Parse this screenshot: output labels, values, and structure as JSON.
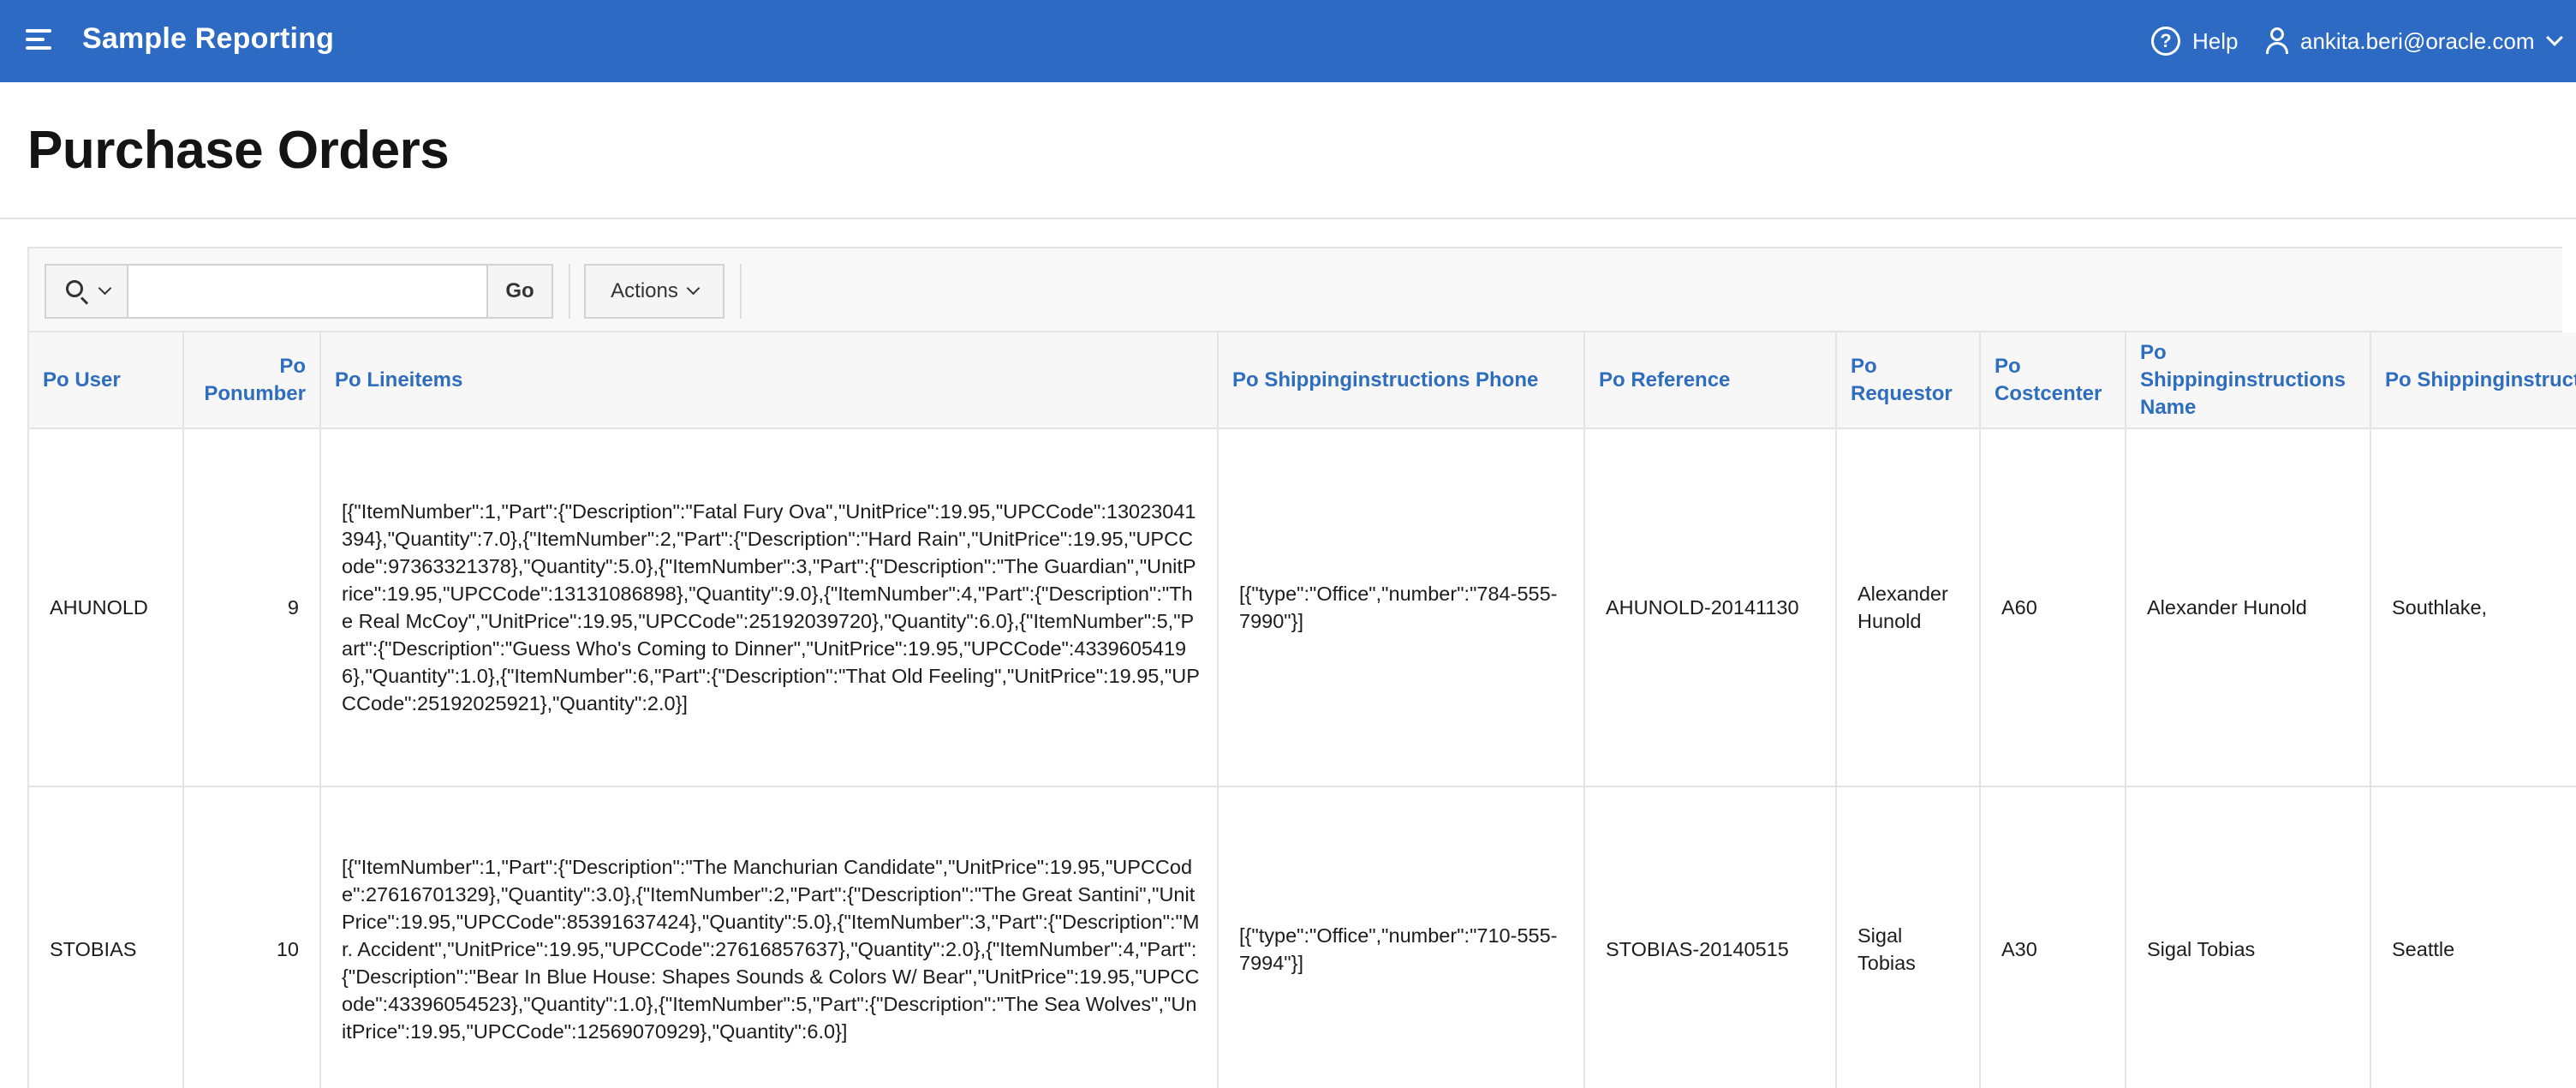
{
  "header": {
    "app_title": "Sample Reporting",
    "help_label": "Help",
    "user_email": "ankita.beri@oracle.com"
  },
  "page": {
    "title": "Purchase Orders"
  },
  "toolbar": {
    "search_value": "",
    "go_label": "Go",
    "actions_label": "Actions"
  },
  "table": {
    "columns": [
      "Po User",
      "Po Ponumber",
      "Po Lineitems",
      "Po Shippinginstructions Phone",
      "Po Reference",
      "Po Requestor",
      "Po Costcenter",
      "Po Shippinginstructions Name",
      "Po Shippinginstructions Address City"
    ],
    "rows": [
      {
        "user": "AHUNOLD",
        "ponumber": "9",
        "lineitems": "[{\"ItemNumber\":1,\"Part\":{\"Description\":\"Fatal Fury Ova\",\"UnitPrice\":19.95,\"UPCCode\":13023041394},\"Quantity\":7.0},{\"ItemNumber\":2,\"Part\":{\"Description\":\"Hard Rain\",\"UnitPrice\":19.95,\"UPCCode\":97363321378},\"Quantity\":5.0},{\"ItemNumber\":3,\"Part\":{\"Description\":\"The Guardian\",\"UnitPrice\":19.95,\"UPCCode\":13131086898},\"Quantity\":9.0},{\"ItemNumber\":4,\"Part\":{\"Description\":\"The Real McCoy\",\"UnitPrice\":19.95,\"UPCCode\":25192039720},\"Quantity\":6.0},{\"ItemNumber\":5,\"Part\":{\"Description\":\"Guess Who's Coming to Dinner\",\"UnitPrice\":19.95,\"UPCCode\":43396054196},\"Quantity\":1.0},{\"ItemNumber\":6,\"Part\":{\"Description\":\"That Old Feeling\",\"UnitPrice\":19.95,\"UPCCode\":25192025921},\"Quantity\":2.0}]",
        "phone": "[{\"type\":\"Office\",\"number\":\"784-555-7990\"}]",
        "reference": "AHUNOLD-20141130",
        "requestor": "Alexander Hunold",
        "costcenter": "A60",
        "ship_name": "Alexander Hunold",
        "city": "Southlake,"
      },
      {
        "user": "STOBIAS",
        "ponumber": "10",
        "lineitems": "[{\"ItemNumber\":1,\"Part\":{\"Description\":\"The Manchurian Candidate\",\"UnitPrice\":19.95,\"UPCCode\":27616701329},\"Quantity\":3.0},{\"ItemNumber\":2,\"Part\":{\"Description\":\"The Great Santini\",\"UnitPrice\":19.95,\"UPCCode\":85391637424},\"Quantity\":5.0},{\"ItemNumber\":3,\"Part\":{\"Description\":\"Mr. Accident\",\"UnitPrice\":19.95,\"UPCCode\":27616857637},\"Quantity\":2.0},{\"ItemNumber\":4,\"Part\":{\"Description\":\"Bear In Blue House: Shapes Sounds & Colors W/ Bear\",\"UnitPrice\":19.95,\"UPCCode\":43396054523},\"Quantity\":1.0},{\"ItemNumber\":5,\"Part\":{\"Description\":\"The Sea Wolves\",\"UnitPrice\":19.95,\"UPCCode\":12569070929},\"Quantity\":6.0}]",
        "phone": "[{\"type\":\"Office\",\"number\":\"710-555-7994\"}]",
        "reference": "STOBIAS-20140515",
        "requestor": "Sigal Tobias",
        "costcenter": "A30",
        "ship_name": "Sigal Tobias",
        "city": "Seattle"
      }
    ]
  },
  "colors": {
    "header_bg": "#2c6ac4",
    "column_header_text": "#2f6dbd"
  }
}
